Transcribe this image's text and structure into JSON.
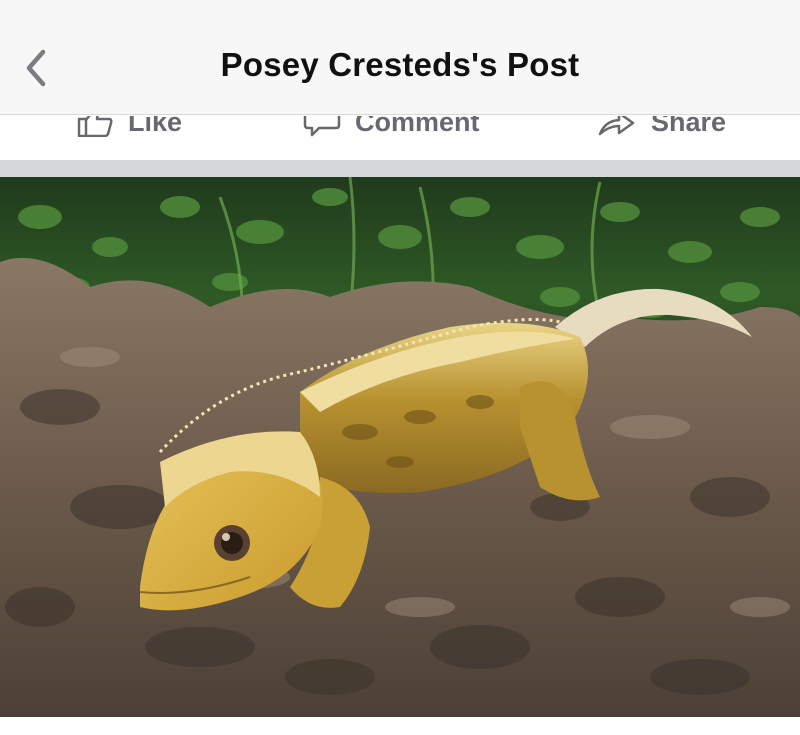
{
  "header": {
    "title": "Posey Cresteds's Post",
    "back_icon": "chevron-left-icon"
  },
  "actions": {
    "like": {
      "label": "Like",
      "icon": "thumbs-up-icon"
    },
    "comment": {
      "label": "Comment",
      "icon": "speech-bubble-icon"
    },
    "share": {
      "label": "Share",
      "icon": "share-arrow-icon"
    }
  },
  "colors": {
    "header_bg": "#f7f7f7",
    "title_text": "#111111",
    "action_text": "#666a70",
    "divider": "#d5d8db"
  }
}
